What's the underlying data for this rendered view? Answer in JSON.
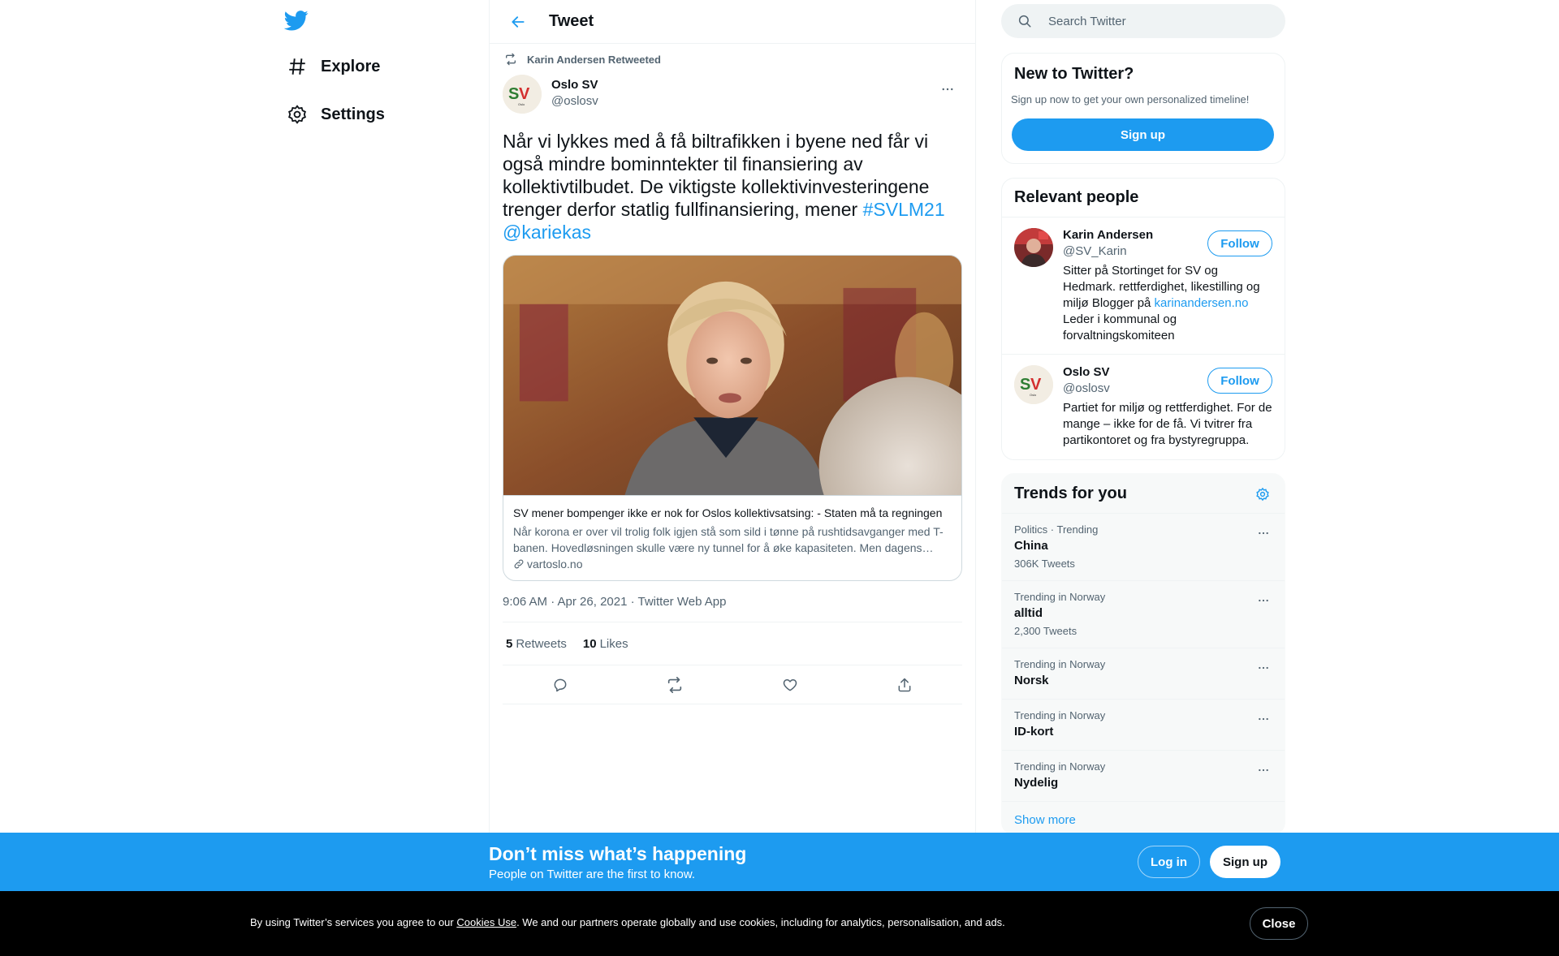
{
  "nav": {
    "logo_icon": "twitter-bird-icon",
    "explore_label": "Explore",
    "settings_label": "Settings"
  },
  "header": {
    "title": "Tweet"
  },
  "tweet": {
    "retweeted_by": "Karin Andersen Retweeted",
    "author_name": "Oslo SV",
    "author_handle": "@oslosv",
    "text_main": "Når vi lykkes med å få biltrafikken i byene ned får vi også mindre bominntekter til finansiering av kollektivtilbudet. De viktigste kollektivinvesteringene trenger derfor statlig fullfinansiering, mener ",
    "hashtag": "#SVLM21",
    "mention": "@kariekas",
    "card": {
      "title": "SV mener bompenger ikke er nok for Oslos kollektivsatsing: - Staten må ta regningen",
      "description": "Når korona er over vil trolig folk igjen stå som sild i tønne på rushtidsavganger med T-banen. Hovedløsningen skulle være ny tunnel for å øke kapasiteten. Men dagens regjering vil ikke ta regningen.",
      "domain": "vartoslo.no"
    },
    "timestamp": "9:06 AM · Apr 26, 2021 · Twitter Web App",
    "retweets_count": "5",
    "retweets_label": "Retweets",
    "likes_count": "10",
    "likes_label": "Likes"
  },
  "search": {
    "placeholder": "Search Twitter"
  },
  "new_to_twitter": {
    "title": "New to Twitter?",
    "subtitle": "Sign up now to get your own personalized timeline!",
    "signup_label": "Sign up"
  },
  "relevant_people": {
    "title": "Relevant people",
    "people": [
      {
        "name": "Karin Andersen",
        "handle": "@SV_Karin",
        "bio_before": "Sitter på Stortinget for SV og Hedmark. rettferdighet, likestilling og miljø Blogger på ",
        "bio_link": "karinandersen.no",
        "bio_after": " Leder i kommunal og forvaltningskomiteen",
        "follow_label": "Follow"
      },
      {
        "name": "Oslo SV",
        "handle": "@oslosv",
        "bio": "Partiet for miljø og rettferdighet. For de mange – ikke for de få. Vi tvitrer fra partikontoret og fra bystyregruppa.",
        "follow_label": "Follow"
      }
    ]
  },
  "trends": {
    "title": "Trends for you",
    "items": [
      {
        "context": "Politics · Trending",
        "name": "China",
        "count": "306K Tweets"
      },
      {
        "context": "Trending in Norway",
        "name": "alltid",
        "count": "2,300 Tweets"
      },
      {
        "context": "Trending in Norway",
        "name": "Norsk",
        "count": ""
      },
      {
        "context": "Trending in Norway",
        "name": "ID-kort",
        "count": ""
      },
      {
        "context": "Trending in Norway",
        "name": "Nydelig",
        "count": ""
      }
    ],
    "show_more": "Show more"
  },
  "signup_bar": {
    "heading": "Don’t miss what’s happening",
    "subheading": "People on Twitter are the first to know.",
    "login_label": "Log in",
    "signup_label": "Sign up"
  },
  "cookie_bar": {
    "text_before": "By using Twitter’s services you agree to our ",
    "link_text": "Cookies Use",
    "text_after": ". We and our partners operate globally and use cookies, including for analytics, personalisation, and ads.",
    "close_label": "Close"
  },
  "colors": {
    "accent": "#1d9bf0",
    "text_primary": "#0f1419",
    "text_secondary": "#536471"
  }
}
